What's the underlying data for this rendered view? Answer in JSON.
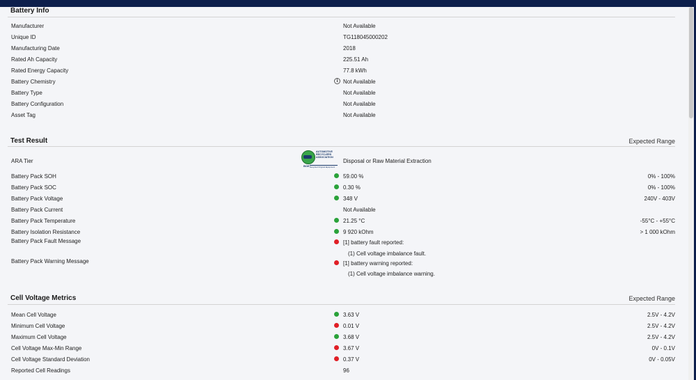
{
  "battery_info": {
    "title": "Battery Info",
    "rows": [
      {
        "label": "Manufacturer",
        "value": "Not Available"
      },
      {
        "label": "Unique ID",
        "value": "TG118045000202"
      },
      {
        "label": "Manufacturing Date",
        "value": "2018"
      },
      {
        "label": "Rated Ah Capacity",
        "value": "225.51 Ah"
      },
      {
        "label": "Rated Energy Capacity",
        "value": "77.8 kWh"
      },
      {
        "label": "Battery Chemistry",
        "value": "Not Available",
        "icon": "info-icon"
      },
      {
        "label": "Battery Type",
        "value": "Not Available"
      },
      {
        "label": "Battery Configuration",
        "value": "Not Available"
      },
      {
        "label": "Asset Tag",
        "value": "Not Available"
      }
    ]
  },
  "test_result": {
    "title": "Test Result",
    "range_header": "Expected Range",
    "ara": {
      "label": "ARA Tier",
      "value": "Disposal or Raw Material Extraction",
      "logo_text": "AUTOMOTIVE\nRECYCLERS\nASSOCIATION",
      "logo_code": "BOE",
      "logo_tagline": "Recycled Original Equipment"
    },
    "rows": [
      {
        "label": "Battery Pack SOH",
        "value": "59.00 %",
        "status": "green",
        "range": "0% - 100%"
      },
      {
        "label": "Battery Pack SOC",
        "value": "0.30 %",
        "status": "green",
        "range": "0% - 100%"
      },
      {
        "label": "Battery Pack Voltage",
        "value": "348 V",
        "status": "green",
        "range": "240V - 403V"
      },
      {
        "label": "Battery Pack Current",
        "value": "Not Available"
      },
      {
        "label": "Battery Pack Temperature",
        "value": "21.25 °C",
        "status": "green",
        "range": "-55°C - +55°C"
      },
      {
        "label": "Battery Isolation Resistance",
        "value": "9 920 kOhm",
        "status": "green",
        "range": "> 1 000 kOhm"
      }
    ],
    "fault": {
      "label": "Battery Pack Fault Message",
      "value": "[1] battery fault reported:",
      "detail": "(1) Cell voltage imbalance fault.",
      "status": "red"
    },
    "warning": {
      "label": "Battery Pack Warning Message",
      "value": "[1] battery warning reported:",
      "detail": "(1) Cell voltage imbalance warning.",
      "status": "red"
    }
  },
  "cell_voltage": {
    "title": "Cell Voltage Metrics",
    "range_header": "Expected Range",
    "rows": [
      {
        "label": "Mean Cell Voltage",
        "value": "3.63 V",
        "status": "green",
        "range": "2.5V - 4.2V"
      },
      {
        "label": "Minimum Cell Voltage",
        "value": "0.01 V",
        "status": "red",
        "range": "2.5V - 4.2V"
      },
      {
        "label": "Maximum Cell Voltage",
        "value": "3.68 V",
        "status": "green",
        "range": "2.5V - 4.2V"
      },
      {
        "label": "Cell Voltage Max-Min Range",
        "value": "3.67 V",
        "status": "red",
        "range": "0V - 0.1V"
      },
      {
        "label": "Cell Voltage Standard Deviation",
        "value": "0.37 V",
        "status": "red",
        "range": "0V - 0.05V"
      },
      {
        "label": "Reported Cell Readings",
        "value": "96"
      }
    ]
  },
  "colors": {
    "header_bar": "#0d1f4c",
    "status_green": "#2aa23a",
    "status_red": "#e01f26"
  }
}
